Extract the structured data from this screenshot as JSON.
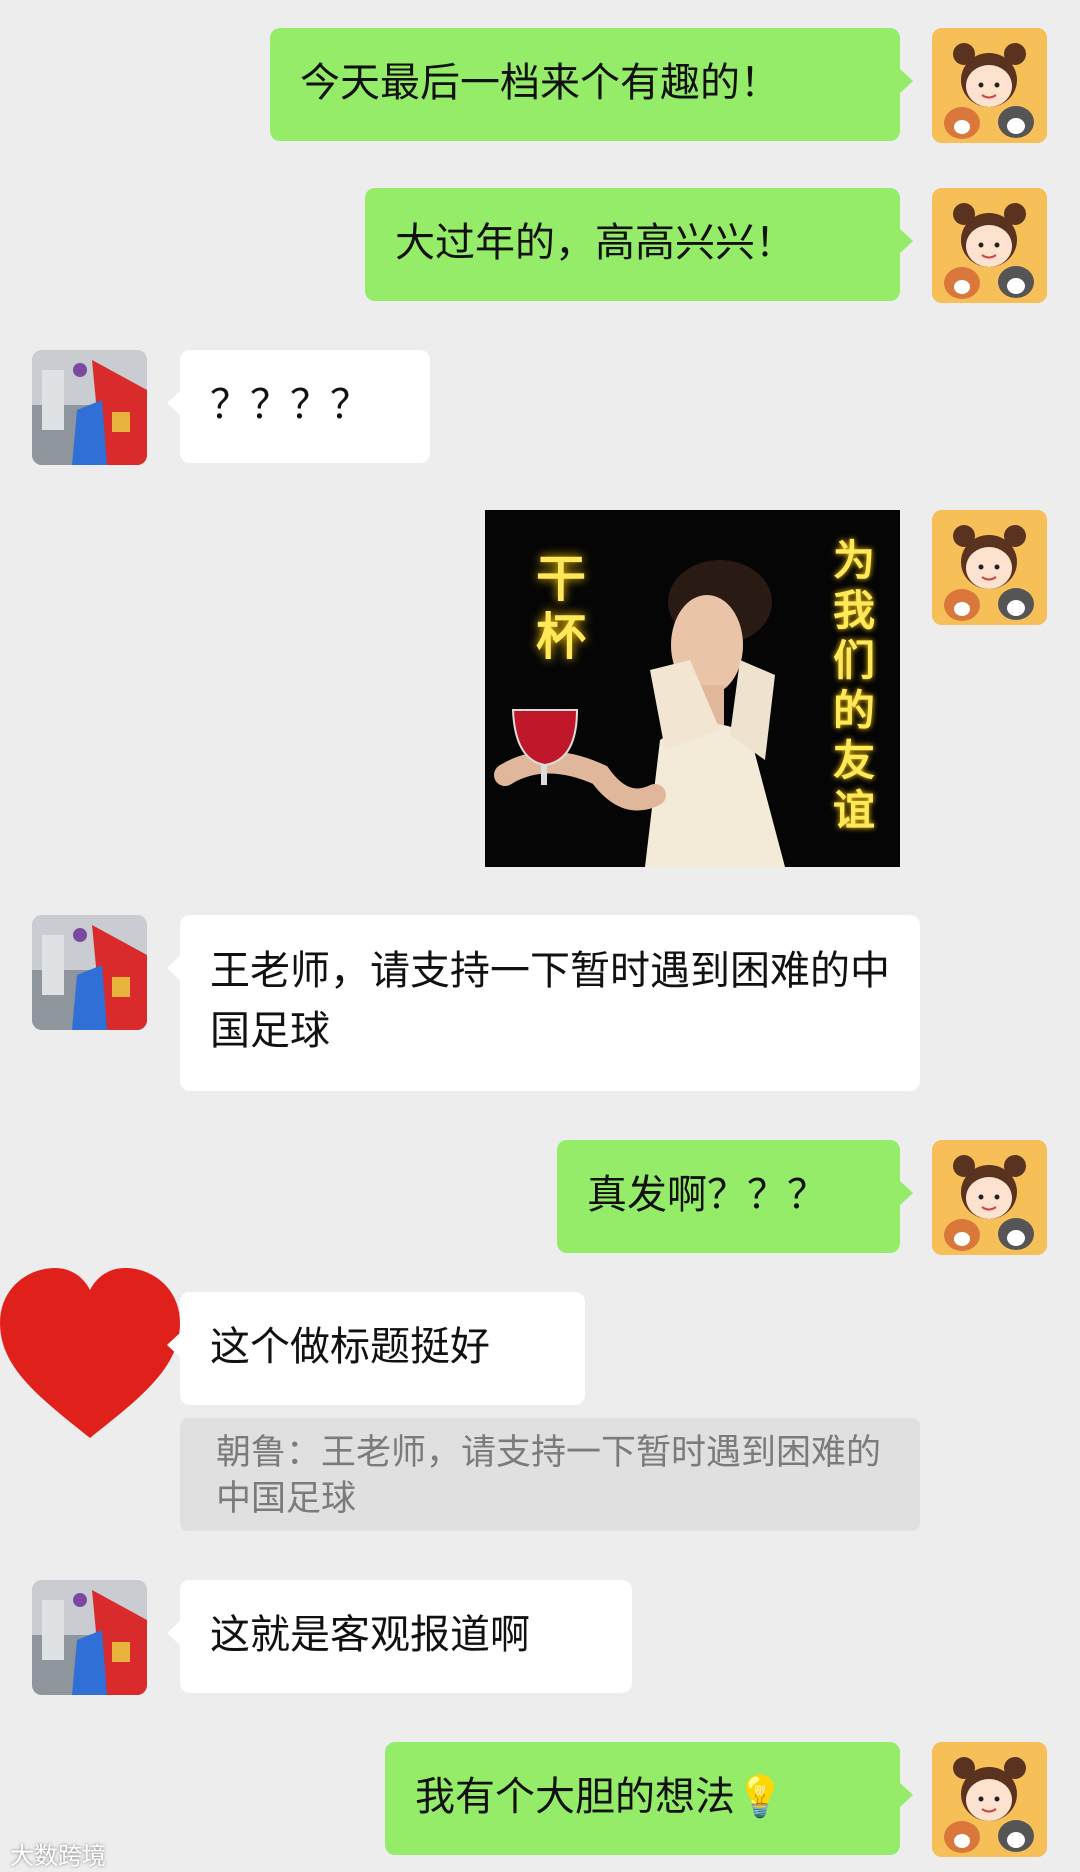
{
  "messages": [
    {
      "side": "right",
      "text": "今天最后一档来个有趣的！"
    },
    {
      "side": "right",
      "text": "大过年的，高高兴兴！"
    },
    {
      "side": "left",
      "text": "？？？？"
    },
    {
      "side": "right",
      "type": "sticker",
      "left_text": "干杯",
      "right_text": "为我们的友谊"
    },
    {
      "side": "left",
      "text": "王老师，请支持一下暂时遇到困难的中国足球"
    },
    {
      "side": "right",
      "text": "真发啊？？？"
    },
    {
      "side": "left",
      "text": "这个做标题挺好",
      "quote": "朝鲁：王老师，请支持一下暂时遇到困难的中国足球"
    },
    {
      "side": "left",
      "text": "这就是客观报道啊"
    },
    {
      "side": "right",
      "text": "我有个大胆的想法💡"
    }
  ],
  "watermark": "大数跨境",
  "colors": {
    "background": "#ededed",
    "my_bubble": "#95ec69",
    "other_bubble": "#ffffff"
  }
}
